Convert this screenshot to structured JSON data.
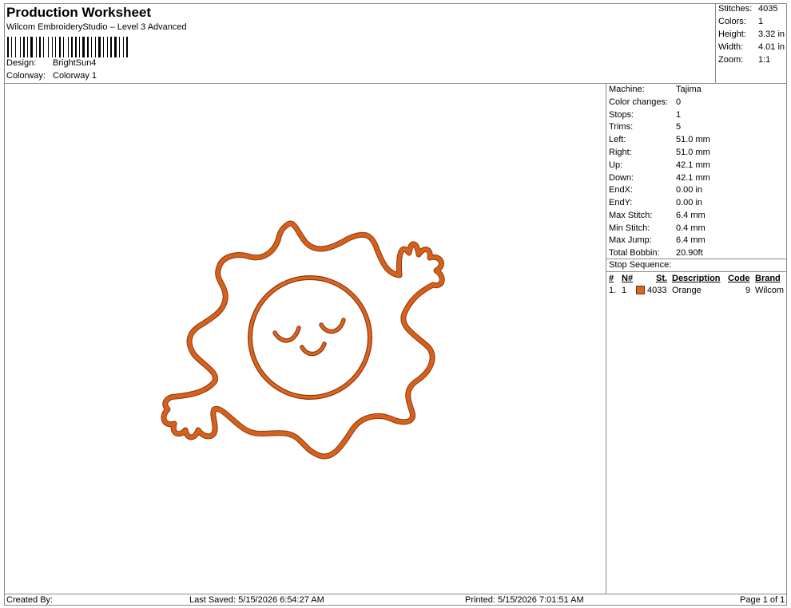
{
  "header": {
    "title": "Production Worksheet",
    "subtitle": "Wilcom EmbroideryStudio – Level 3 Advanced",
    "design_label": "Design:",
    "design_value": "BrightSun4",
    "colorway_label": "Colorway:",
    "colorway_value": "Colorway 1"
  },
  "summary": [
    {
      "label": "Stitches:",
      "value": "4035"
    },
    {
      "label": "Colors:",
      "value": "1"
    },
    {
      "label": "Height:",
      "value": "3.32 in"
    },
    {
      "label": "Width:",
      "value": "4.01 in"
    },
    {
      "label": "Zoom:",
      "value": "1:1"
    }
  ],
  "properties": [
    {
      "label": "Machine:",
      "value": "Tajima"
    },
    {
      "label": "Color changes:",
      "value": "0"
    },
    {
      "label": "Stops:",
      "value": "1"
    },
    {
      "label": "Trims:",
      "value": "5"
    },
    {
      "label": "Left:",
      "value": "51.0 mm"
    },
    {
      "label": "Right:",
      "value": "51.0 mm"
    },
    {
      "label": "Up:",
      "value": "42.1 mm"
    },
    {
      "label": "Down:",
      "value": "42.1 mm"
    },
    {
      "label": "EndX:",
      "value": "0.00 in"
    },
    {
      "label": "EndY:",
      "value": "0.00 in"
    },
    {
      "label": "Max Stitch:",
      "value": "6.4 mm"
    },
    {
      "label": "Min Stitch:",
      "value": "0.4 mm"
    },
    {
      "label": "Max Jump:",
      "value": "6.4 mm"
    },
    {
      "label": "Total Bobbin:",
      "value": "20.90ft"
    }
  ],
  "stop_sequence": {
    "title": "Stop Sequence:",
    "columns": [
      "#",
      "N#",
      "St.",
      "Description",
      "Code",
      "Brand"
    ],
    "rows": [
      {
        "num": "1.",
        "needle": "1",
        "stitches": "4033",
        "description": "Orange",
        "code": "9",
        "brand": "Wilcom",
        "color": "#e0651e"
      }
    ]
  },
  "footer": {
    "created_by": "Created By:",
    "last_saved": "Last Saved: 5/15/2026 6:54:27 AM",
    "printed": "Printed: 5/15/2026 7:01:51 AM",
    "page": "Page 1 of 1"
  },
  "colors": {
    "thread": "#e0651e",
    "thread_dark": "#8a3a10",
    "border": "#8a8a8a"
  }
}
